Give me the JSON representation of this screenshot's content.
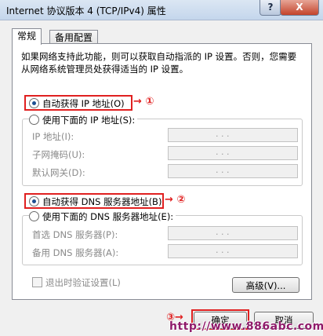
{
  "window": {
    "title": "Internet 协议版本 4 (TCP/IPv4) 属性",
    "help_label": "?",
    "close_label": "X"
  },
  "tabs": [
    {
      "label": "常规",
      "active": true
    },
    {
      "label": "备用配置",
      "active": false
    }
  ],
  "description": "如果网络支持此功能，则可以获取自动指派的 IP 设置。否则，您需要从网络系统管理员处获得适当的 IP 设置。",
  "ip_section": {
    "auto_label": "自动获得 IP 地址(O)",
    "manual_label": "使用下面的 IP 地址(S):",
    "selected": "auto",
    "fields": [
      {
        "label": "IP 地址(I):"
      },
      {
        "label": "子网掩码(U):"
      },
      {
        "label": "默认网关(D):"
      }
    ],
    "callout": "①"
  },
  "dns_section": {
    "auto_label": "自动获得 DNS 服务器地址(B)",
    "manual_label": "使用下面的 DNS 服务器地址(E):",
    "selected": "auto",
    "fields": [
      {
        "label": "首选 DNS 服务器(P):"
      },
      {
        "label": "备用 DNS 服务器(A):"
      }
    ],
    "callout": "②"
  },
  "validate_checkbox": {
    "label": "退出时验证设置(L)",
    "checked": false
  },
  "buttons": {
    "advanced": "高级(V)...",
    "ok": "确定",
    "cancel": "取消"
  },
  "ok_callout": "③",
  "ip_dots": ". . .",
  "watermark": "http://www.886abc.com",
  "colors": {
    "highlight": "#e02020",
    "selected_radio": "#1d4f91"
  }
}
